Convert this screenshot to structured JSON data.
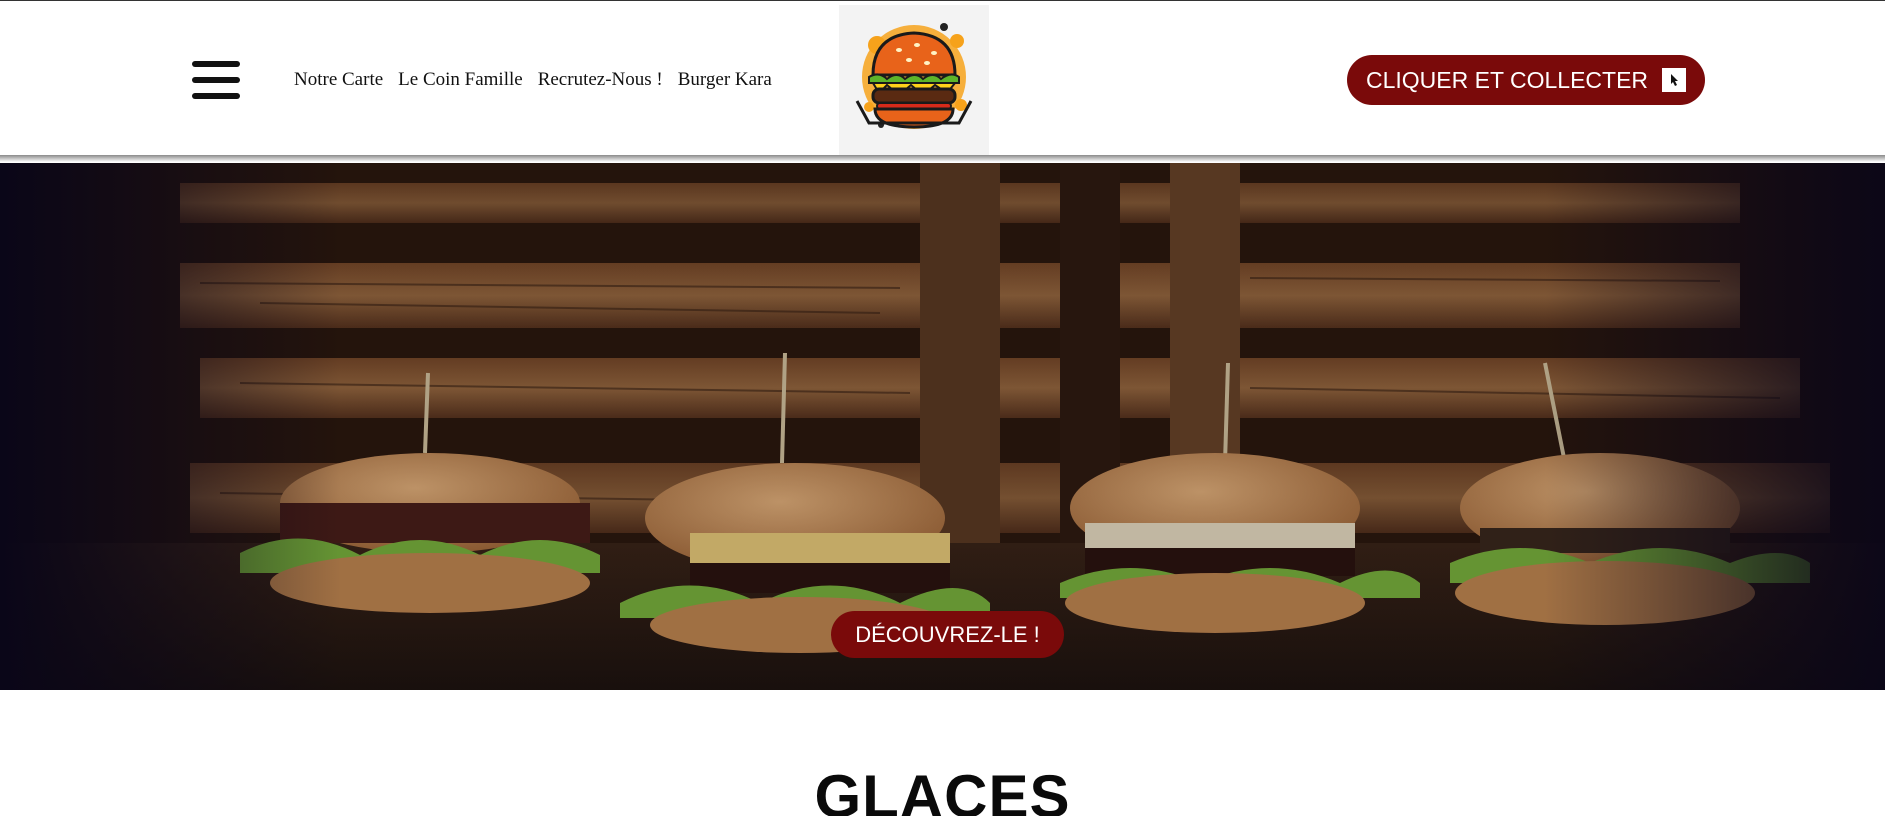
{
  "header": {
    "menu_icon": "hamburger-menu-icon",
    "nav": [
      {
        "label": "Notre Carte"
      },
      {
        "label": "Le Coin Famille"
      },
      {
        "label": "Recrutez-Nous !"
      },
      {
        "label": "Burger Kara"
      }
    ],
    "logo_icon": "burger-logo-icon",
    "cta": {
      "label": "CLIQUER ET COLLECTER",
      "icon": "pointer-cursor-icon"
    }
  },
  "hero": {
    "image": "burgers-on-wooden-table-photo",
    "button_label": "DÉCOUVREZ-LE !"
  },
  "section": {
    "title": "GLACES"
  },
  "colors": {
    "accent": "#7a0a0a",
    "text": "#111111",
    "wood_dark": "#1a0d05",
    "wood_light": "#8a5a30"
  }
}
